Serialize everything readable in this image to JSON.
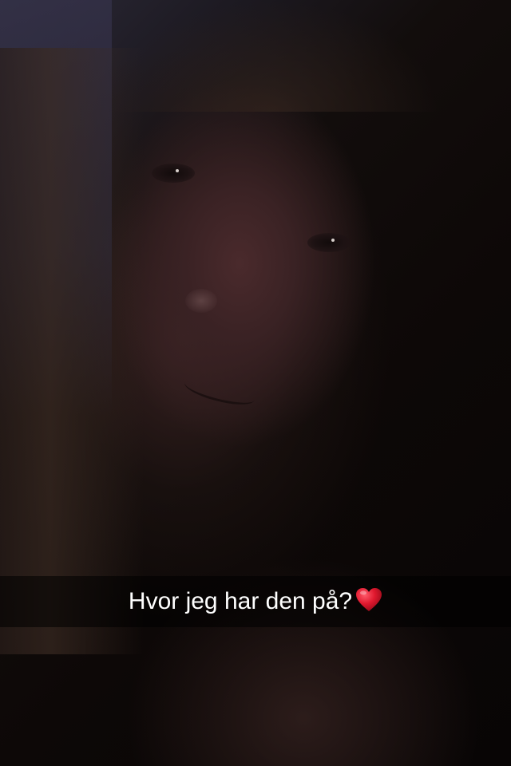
{
  "snap": {
    "caption": {
      "text": "Hvor jeg har den på?",
      "emoji": "heart-icon",
      "emoji_color": "#e0182e"
    },
    "photo": {
      "subject": "selfie"
    }
  }
}
